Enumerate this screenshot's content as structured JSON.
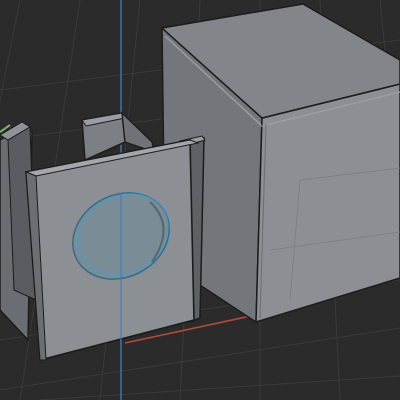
{
  "viewport": {
    "mode": "3d-viewport",
    "objects": [
      "open-box-with-circular-hole",
      "large-cube"
    ],
    "selected_faces": [
      "front-face",
      "circle-cutout"
    ],
    "colors": {
      "background": "#2b2b2b",
      "grid": "#3a3a3a",
      "mesh_fill_light": "#8c8f94",
      "mesh_fill_mid": "#73767b",
      "mesh_fill_dark": "#5e6166",
      "edge": "#1c1c1c",
      "axis_x": "#b34a3a",
      "axis_y": "#7ab26a",
      "axis_z": "#3d7fbf",
      "highlight": "#3aa2d8"
    }
  }
}
